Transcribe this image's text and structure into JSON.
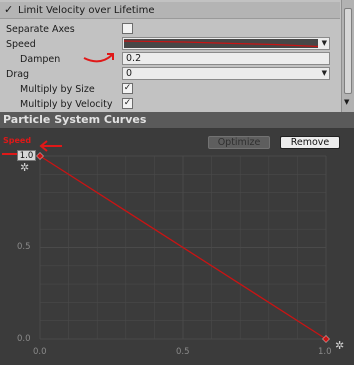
{
  "inspector": {
    "module_title": "Limit Velocity over Lifetime",
    "module_check": "✓",
    "rows": {
      "separate_axes": {
        "label": "Separate Axes",
        "checked": ""
      },
      "speed": {
        "label": "Speed",
        "dropdown": "▼"
      },
      "dampen": {
        "label": "Dampen",
        "value": "0.2"
      },
      "drag": {
        "label": "Drag",
        "value": "0",
        "dropdown": "▼"
      },
      "multiply_by_size": {
        "label": "Multiply by Size",
        "checked": "✓"
      },
      "multiply_by_velocity": {
        "label": "Multiply by Velocity",
        "checked": "✓"
      }
    },
    "scroll_down": "▼"
  },
  "curves_panel": {
    "title": "Particle System Curves",
    "optimize_label": "Optimize",
    "remove_label": "Remove",
    "key_value_label": "1.0",
    "annotation_label": "Speed",
    "gear_glyph": "✲",
    "y_ticks": [
      "1.0",
      "0.5",
      "0.0"
    ],
    "x_ticks": [
      "0.0",
      "0.5",
      "1.0"
    ]
  },
  "colors": {
    "curve": "#c81414",
    "annotation": "#e01818",
    "grid": "#4a4a4a",
    "plot_background": "#3b3b3b"
  },
  "chart_data": {
    "type": "line",
    "series": [
      {
        "values": [
          {
            "x": 0.0,
            "y": 1.0
          },
          {
            "x": 1.0,
            "y": 0.0
          }
        ]
      }
    ],
    "xlim": [
      0.0,
      1.0
    ],
    "ylim": [
      0.0,
      1.0
    ],
    "x_ticks": [
      0.0,
      0.5,
      1.0
    ],
    "y_ticks": [
      0.0,
      0.5,
      1.0
    ],
    "grid": true
  }
}
